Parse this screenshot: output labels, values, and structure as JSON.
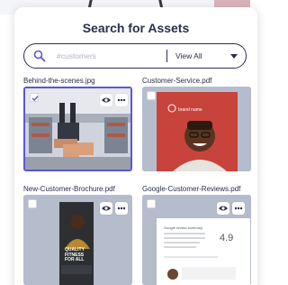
{
  "modal": {
    "title": "Search for Assets"
  },
  "search": {
    "placeholder": "#customers",
    "filter_selected": "View All"
  },
  "assets": [
    {
      "name": "Behind-the-scenes.jpg",
      "selected": true,
      "thumbnail": "warehouse-photo"
    },
    {
      "name": "Customer-Service.pdf",
      "selected": false,
      "thumbnail": "smiling-man-photo"
    },
    {
      "name": "New-Customer-Brochure.pdf",
      "selected": false,
      "thumbnail": "brochure-cover"
    },
    {
      "name": "Google-Customer-Reviews.pdf",
      "selected": false,
      "thumbnail": "reviews-document"
    }
  ],
  "thumbnails": {
    "customer_service_brand": "brand name",
    "brochure_text": "QUALITY FITNESS FOR ALL",
    "reviews_title": "Google review summary",
    "reviews_score": "4.9"
  },
  "colors": {
    "accent": "#5b57d1",
    "text": "#2b2e4a",
    "card_bg": "#b5bccb"
  }
}
